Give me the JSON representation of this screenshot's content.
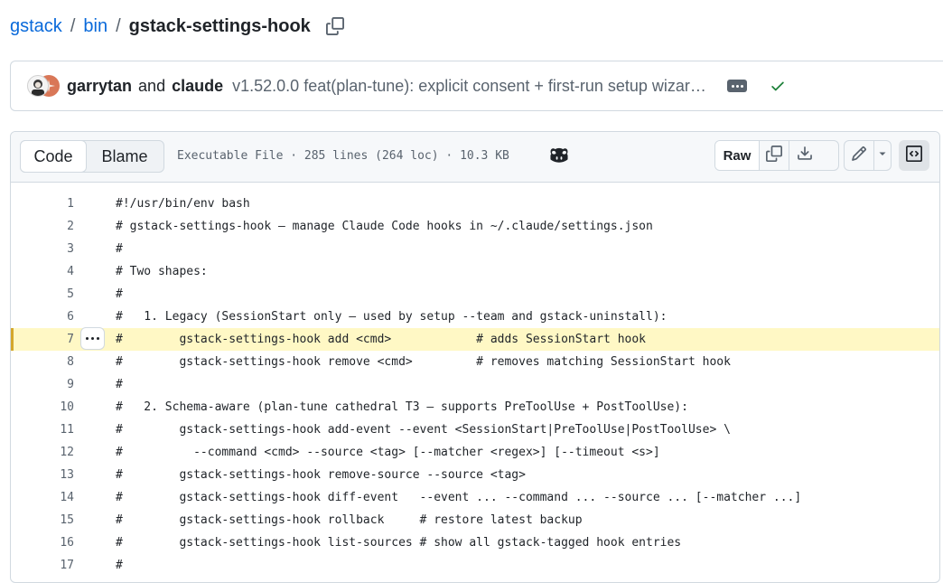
{
  "breadcrumb": {
    "repo": "gstack",
    "folder": "bin",
    "file": "gstack-settings-hook",
    "separator": "/"
  },
  "commit": {
    "author1": "garrytan",
    "conjunction": "and",
    "author2": "claude",
    "message": "v1.52.0.0 feat(plan-tune): explicit consent + first-run setup wizard …",
    "status": "success",
    "status_color": "#1a7f37"
  },
  "file_header": {
    "tab_code": "Code",
    "tab_blame": "Blame",
    "meta": "Executable File · 285 lines (264 loc) · 10.3 KB",
    "raw_label": "Raw"
  },
  "highlighted_line": 7,
  "lines": [
    {
      "num": "1",
      "code": "#!/usr/bin/env bash"
    },
    {
      "num": "2",
      "code": "# gstack-settings-hook — manage Claude Code hooks in ~/.claude/settings.json"
    },
    {
      "num": "3",
      "code": "#"
    },
    {
      "num": "4",
      "code": "# Two shapes:"
    },
    {
      "num": "5",
      "code": "#"
    },
    {
      "num": "6",
      "code": "#   1. Legacy (SessionStart only — used by setup --team and gstack-uninstall):"
    },
    {
      "num": "7",
      "code": "#        gstack-settings-hook add <cmd>            # adds SessionStart hook"
    },
    {
      "num": "8",
      "code": "#        gstack-settings-hook remove <cmd>         # removes matching SessionStart hook"
    },
    {
      "num": "9",
      "code": "#"
    },
    {
      "num": "10",
      "code": "#   2. Schema-aware (plan-tune cathedral T3 — supports PreToolUse + PostToolUse):"
    },
    {
      "num": "11",
      "code": "#        gstack-settings-hook add-event --event <SessionStart|PreToolUse|PostToolUse> \\"
    },
    {
      "num": "12",
      "code": "#          --command <cmd> --source <tag> [--matcher <regex>] [--timeout <s>]"
    },
    {
      "num": "13",
      "code": "#        gstack-settings-hook remove-source --source <tag>"
    },
    {
      "num": "14",
      "code": "#        gstack-settings-hook diff-event   --event ... --command ... --source ... [--matcher ...]"
    },
    {
      "num": "15",
      "code": "#        gstack-settings-hook rollback     # restore latest backup"
    },
    {
      "num": "16",
      "code": "#        gstack-settings-hook list-sources # show all gstack-tagged hook entries"
    },
    {
      "num": "17",
      "code": "#"
    }
  ]
}
